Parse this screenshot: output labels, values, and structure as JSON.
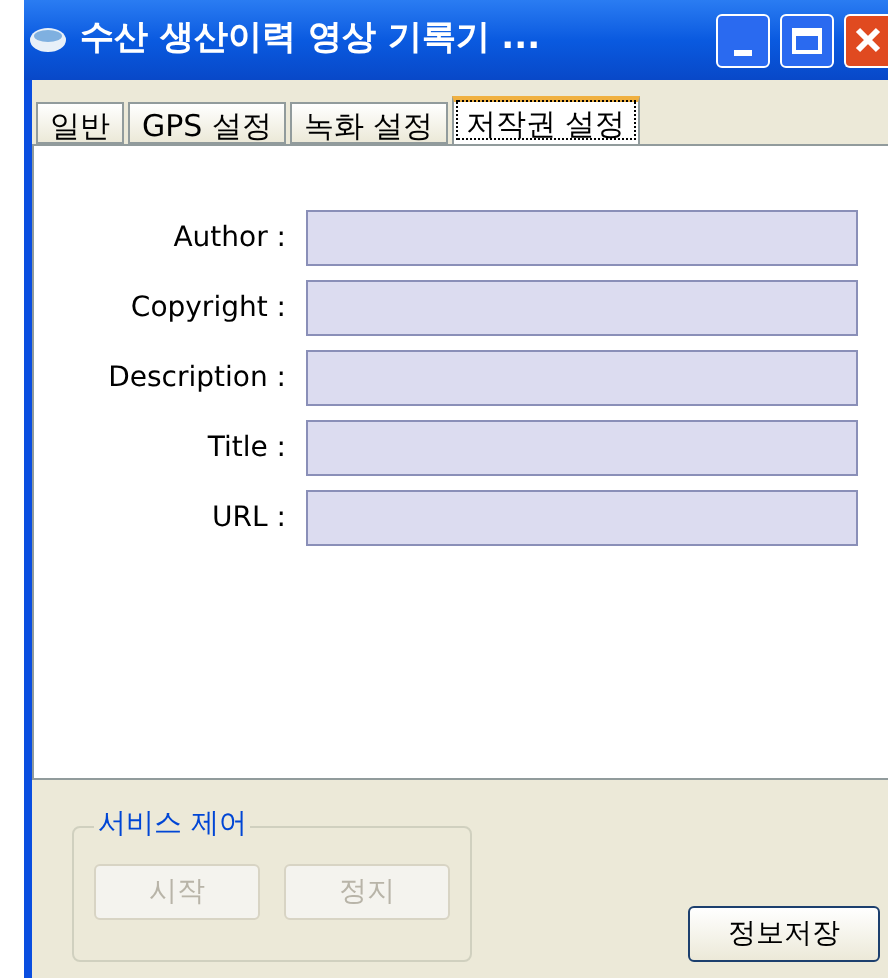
{
  "window": {
    "title": "수산 생산이력 영상 기록기 ..."
  },
  "tabs": [
    {
      "label": "일반",
      "selected": false
    },
    {
      "label": "GPS 설정",
      "selected": false
    },
    {
      "label": "녹화 설정",
      "selected": false
    },
    {
      "label": "저작권 설정",
      "selected": true
    }
  ],
  "fields": [
    {
      "label": "Author :"
    },
    {
      "label": "Copyright :"
    },
    {
      "label": "Description :"
    },
    {
      "label": "Title :"
    },
    {
      "label": "URL :"
    }
  ],
  "service_control": {
    "title": "서비스 제어",
    "buttons": [
      {
        "label": "시작",
        "disabled": true
      },
      {
        "label": "정지",
        "disabled": true
      }
    ]
  },
  "save_button": {
    "label": "정보저장",
    "disabled": false
  }
}
